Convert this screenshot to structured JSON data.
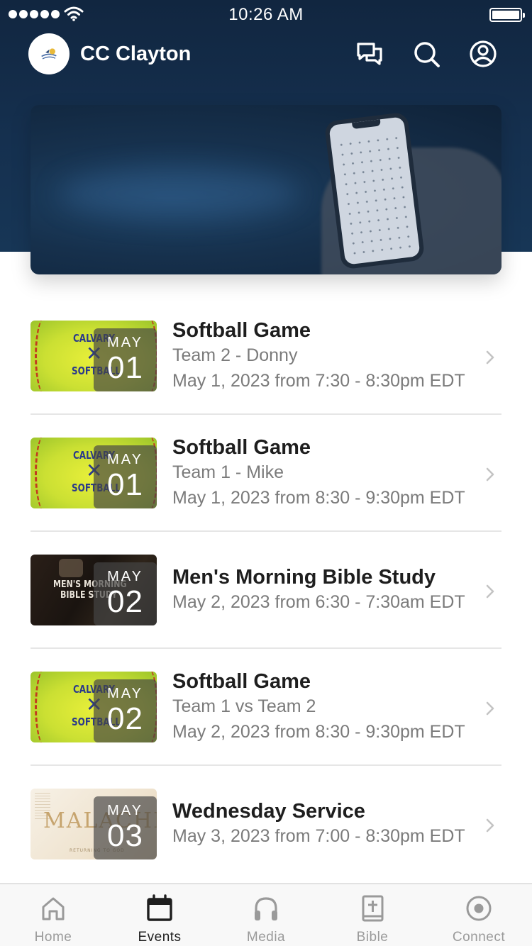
{
  "status_bar": {
    "time": "10:26 AM"
  },
  "header": {
    "title": "CC Clayton",
    "icons": [
      "chat-icon",
      "search-icon",
      "profile-icon"
    ]
  },
  "events": [
    {
      "title": "Softball Game",
      "subtitle": "Team 2 - Donny",
      "schedule": "May 1, 2023 from 7:30 - 8:30pm EDT",
      "month": "MAY",
      "day": "01",
      "thumbnail": "softball",
      "thumb_text": [
        "CALVARY",
        "✕",
        "SOFTBALL"
      ]
    },
    {
      "title": "Softball Game",
      "subtitle": "Team 1 - Mike",
      "schedule": "May 1, 2023 from 8:30 - 9:30pm EDT",
      "month": "MAY",
      "day": "01",
      "thumbnail": "softball",
      "thumb_text": [
        "CALVARY",
        "✕",
        "SOFTBALL"
      ]
    },
    {
      "title": "Men's Morning Bible Study",
      "subtitle": "May 2, 2023 from 6:30 - 7:30am EDT",
      "month": "MAY",
      "day": "02",
      "thumbnail": "men",
      "thumb_text": [
        "MEN'S MORNING",
        "BIBLE STUDY"
      ]
    },
    {
      "title": "Softball Game",
      "subtitle": "Team 1 vs Team 2",
      "schedule": "May 2, 2023 from 8:30 - 9:30pm EDT",
      "month": "MAY",
      "day": "02",
      "thumbnail": "softball",
      "thumb_text": [
        "CALVARY",
        "✕",
        "SOFTBALL"
      ]
    },
    {
      "title": "Wednesday Service",
      "subtitle": "May 3, 2023 from 7:00 - 8:30pm EDT",
      "month": "MAY",
      "day": "03",
      "thumbnail": "malachi",
      "thumb_text": [
        "MALACHI",
        "RETURNING TO GOD"
      ]
    }
  ],
  "tab_bar": {
    "active": "Events",
    "tabs": [
      {
        "label": "Home",
        "icon": "home-icon"
      },
      {
        "label": "Events",
        "icon": "calendar-icon"
      },
      {
        "label": "Media",
        "icon": "headphones-icon"
      },
      {
        "label": "Bible",
        "icon": "bible-icon"
      },
      {
        "label": "Connect",
        "icon": "connect-icon"
      }
    ]
  },
  "colors": {
    "header_bg": "#15304f",
    "text_primary": "#1e1e1e",
    "text_secondary": "#7b7b7b",
    "tab_inactive": "#9a9a9a"
  }
}
